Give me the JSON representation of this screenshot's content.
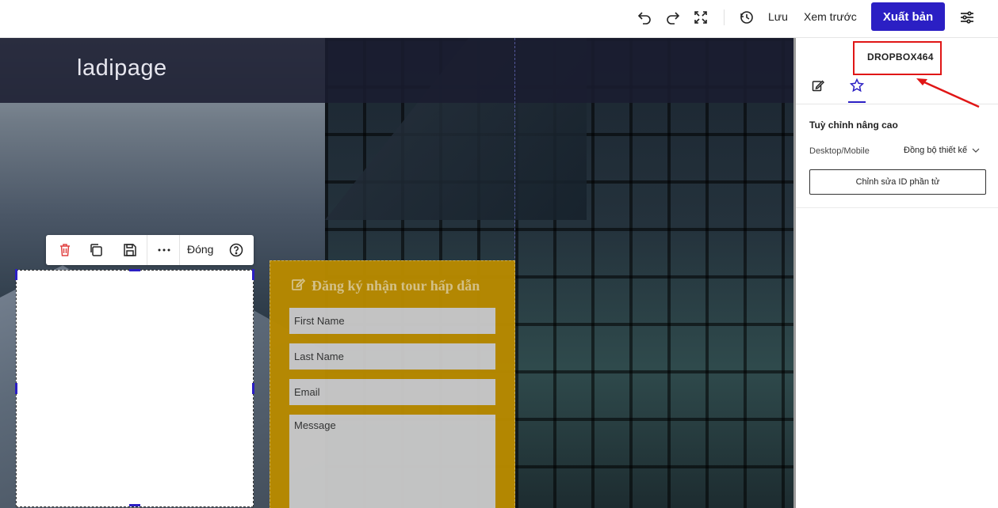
{
  "toolbar": {
    "undo_icon": "undo-icon",
    "redo_icon": "redo-icon",
    "fullscreen_icon": "fullscreen-icon",
    "history_icon": "history-icon",
    "save_label": "Lưu",
    "preview_label": "Xem trước",
    "publish_label": "Xuất bản",
    "settings_icon": "sliders-icon",
    "accent_color": "#2b1fc4"
  },
  "canvas": {
    "logo": "ladipage",
    "form": {
      "title": "Đăng ký nhận tour hấp dẫn",
      "first_name_placeholder": "First Name",
      "last_name_placeholder": "Last Name",
      "email_placeholder": "Email",
      "message_placeholder": "Message",
      "background_color": "#b88a00"
    }
  },
  "element_toolbar": {
    "delete_icon": "trash-icon",
    "duplicate_icon": "copy-icon",
    "save_icon": "floppy-icon",
    "more_icon": "more-horizontal-icon",
    "close_label": "Đóng",
    "help_icon": "help-circle-icon"
  },
  "right_panel": {
    "element_id": "DROPBOX464",
    "tabs": [
      "edit-icon",
      "star-icon"
    ],
    "section_title": "Tuỳ chỉnh nâng cao",
    "device_label": "Desktop/Mobile",
    "sync_select_value": "Đồng bộ thiết kế",
    "edit_id_button": "Chỉnh sửa ID phần tử",
    "highlight_color": "#e01616"
  }
}
